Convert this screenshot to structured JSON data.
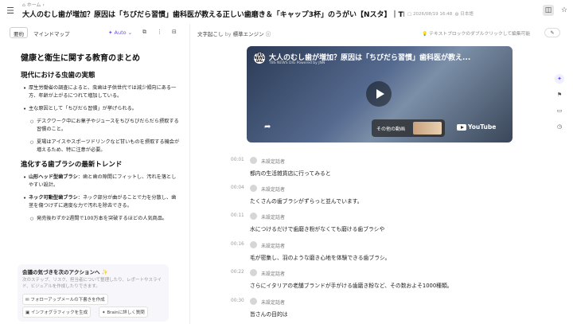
{
  "header": {
    "menu_icon": "menu-icon",
    "breadcrumb": "ホーム",
    "title": "大人のむし歯が増加？原因は「ちびだら習慣」歯科医が教える正しい歯磨き＆「キャップ3杯」のうがい【Nスタ】｜TBS NEWS DIG",
    "date": "2026/08/19 16:48",
    "language": "日本語",
    "layout_icon": "sidebar-toggle-icon",
    "star_icon": "star-icon"
  },
  "left": {
    "tabs": [
      "要約",
      "マインドマップ"
    ],
    "active_tab": 0,
    "auto_label": "Auto",
    "outline": {
      "title": "健康と衛生に関する教育のまとめ",
      "sections": [
        {
          "heading": "現代における虫歯の実態",
          "items": [
            {
              "text": "厚生労働省の調査によると、虫歯は子供世代では減少傾向にある一方、年齢が上がるにつれて増加している。",
              "level": 0
            },
            {
              "text": "主な原因として「ちびだら習慣」が挙げられる。",
              "level": 0
            },
            {
              "text": "デスクワーク中にお菓子やジュースをちびちびだらだら摂取する習慣のこと。",
              "level": 1
            },
            {
              "text": "夏場はアイスやスポーツドリンクなど甘いものを摂取する機会が増えるため、特に注意が必要。",
              "level": 1
            }
          ]
        },
        {
          "heading": "進化する歯ブラシの最新トレンド",
          "items": [
            {
              "bold": "山形ヘッド型歯ブラシ",
              "text": "：歯と歯の隙間にフィットし、汚れを落としやすい設計。",
              "level": 0
            },
            {
              "bold": "ネック可動型歯ブラシ",
              "text": "：ネック部分が曲がることで力を分散し、歯茎を傷つけずに適度な力で汚れを除去できる。",
              "level": 0
            },
            {
              "text": "発売後わずか2週間で100万本を突破するほどの人気商品。",
              "level": 1
            }
          ]
        }
      ]
    },
    "action_card": {
      "title": "会議の気づきを次のアクションへ ✨",
      "desc": "次のステップ、リスク、担当者について整理したり、レポートやスライド、ビジュアルを作成したりできます。",
      "chips": [
        "フォローアップメールの下書きを作成",
        "インフォグラフィックを生成",
        "Brainに詳しく質問"
      ]
    }
  },
  "right": {
    "transcript_label": "文字起こし",
    "by_label": "by",
    "engine_label": "標準エンジン",
    "hint": "テキストブロックのダブルクリックして編集可能",
    "video": {
      "logo": "TBS NEWS DIG",
      "title": "大人のむし歯が増加？原因は「ちびだら習慣」歯科医が教え...",
      "subtitle": "TBS NEWS DIG Powered by JNN",
      "more_videos": "その他の動画",
      "youtube": "YouTube"
    },
    "segments": [
      {
        "time": "00:01",
        "speaker": "未設定話者",
        "text": "都内の生活雑貨店に行ってみると"
      },
      {
        "time": "00:04",
        "speaker": "未設定話者",
        "text": "たくさんの歯ブラシがずらっと並んでいます。"
      },
      {
        "time": "00:11",
        "speaker": "未設定話者",
        "text": "水につけるだけで歯磨き粉がなくても磨ける歯ブラシや"
      },
      {
        "time": "00:16",
        "speaker": "未設定話者",
        "text": "毛が密集し、羽のような磨き心地を体験できる歯ブラシ。"
      },
      {
        "time": "00:22",
        "speaker": "未設定話者",
        "text": "さらにイタリアの老舗ブランドが手がける歯磨き粉など、その数およそ1000種類。"
      },
      {
        "time": "00:30",
        "speaker": "未設定話者",
        "text": "皆さんの目的は"
      }
    ]
  }
}
